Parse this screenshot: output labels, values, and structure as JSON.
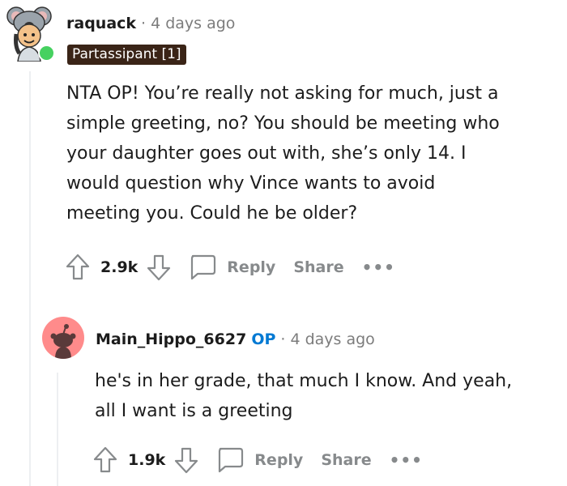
{
  "comments": [
    {
      "username": "raquack",
      "separator": "·",
      "time": "4 days ago",
      "flair": "Partassipant [1]",
      "body_lines": [
        "NTA OP! You’re really not asking for much, just a",
        "simple greeting, no? You should be meeting who",
        "your daughter goes out with, she’s only 14. I",
        "would question why Vince wants to avoid",
        "meeting you. Could he be older?"
      ],
      "votes": "2.9k",
      "reply_label": "Reply",
      "share_label": "Share",
      "more_label": "•••",
      "online": true
    },
    {
      "username": "Main_Hippo_6627",
      "op_badge": "OP",
      "separator": "·",
      "time": "4 days ago",
      "body_lines": [
        "he's in her grade, that much I know. And yeah,",
        "all I want is a greeting"
      ],
      "votes": "1.9k",
      "reply_label": "Reply",
      "share_label": "Share",
      "more_label": "•••"
    }
  ],
  "colors": {
    "flair_bg": "#3a2417",
    "op_blue": "#0079d3",
    "meta_gray": "#7c7c7c",
    "action_gray": "#878a8c",
    "online_green": "#46d160",
    "avatar2_bg": "#ff8b8b"
  }
}
